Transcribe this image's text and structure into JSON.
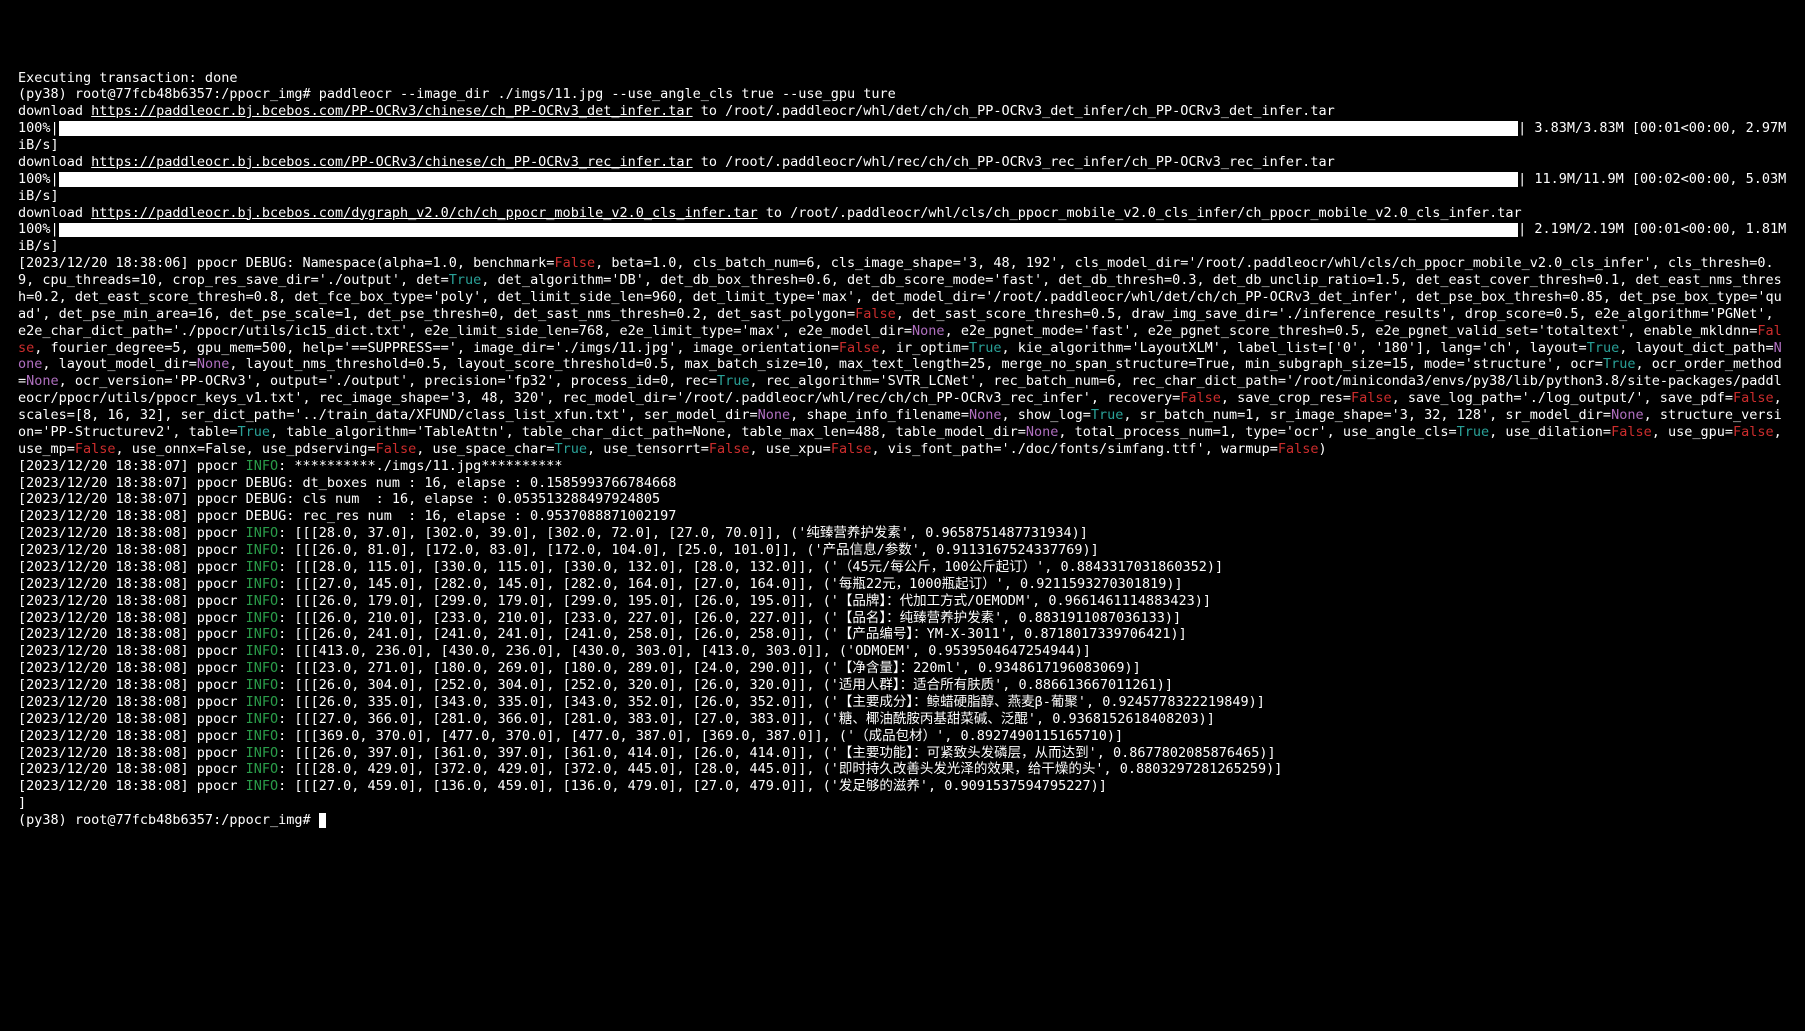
{
  "lines": {
    "l0": "Executing transaction: done",
    "l1_prompt": "(py38) root@77fcb48b6357:/ppocr_img# paddleocr --image_dir ./imgs/11.jpg --use_angle_cls true --use_gpu ture",
    "dl1_a": "download ",
    "dl1_url": "https://paddleocr.bj.bcebos.com/PP-OCRv3/chinese/ch_PP-OCRv3_det_infer.tar",
    "dl1_b": " to /root/.paddleocr/whl/det/ch/ch_PP-OCRv3_det_infer/ch_PP-OCRv3_det_infer.tar",
    "p1_left": "100%|",
    "p1_right": "| 3.83M/3.83M [00:01<00:00, 2.97MiB/s]",
    "dl2_a": "download ",
    "dl2_url": "https://paddleocr.bj.bcebos.com/PP-OCRv3/chinese/ch_PP-OCRv3_rec_infer.tar",
    "dl2_b": " to /root/.paddleocr/whl/rec/ch/ch_PP-OCRv3_rec_infer/ch_PP-OCRv3_rec_infer.tar",
    "p2_left": "100%|",
    "p2_right": "| 11.9M/11.9M [00:02<00:00, 5.03MiB/s]",
    "dl3_a": "download ",
    "dl3_url": "https://paddleocr.bj.bcebos.com/dygraph_v2.0/ch/ch_ppocr_mobile_v2.0_cls_infer.tar",
    "dl3_b": " to /root/.paddleocr/whl/cls/ch_ppocr_mobile_v2.0_cls_infer/ch_ppocr_mobile_v2.0_cls_infer.tar",
    "p3_left": "100%|",
    "p3_right": "| 2.19M/2.19M [00:01<00:00, 1.81MiB/s]"
  },
  "debug_block": {
    "prefix": "[2023/12/20 18:38:06] ppocr DEBUG: Namespace(alpha=1.0, benchmark=",
    "seg": [
      {
        "t": "False",
        "c": "red"
      },
      {
        "t": ", beta=1.0, cls_batch_num=6, cls_image_shape='3, 48, 192', cls_model_dir='/root/.paddleocr/whl/cls/ch_ppocr_mobile_v2.0_cls_infer', cls_thresh=0.9, cpu_threads=10, crop_res_save_dir='./output', det=",
        "c": "white"
      },
      {
        "t": "True",
        "c": "cyan"
      },
      {
        "t": ", det_algorithm='DB', det_db_box_thresh=0.6, det_db_score_mode='fast', det_db_thresh=0.3, det_db_unclip_ratio=1.5, det_east_cover_thresh=0.1, det_east_nms_thresh=0.2, det_east_score_thresh=0.8, det_fce_box_type='poly', det_limit_side_len=960, det_limit_type='max', det_model_dir='/root/.paddleocr/whl/det/ch/ch_PP-OCRv3_det_infer', det_pse_box_thresh=0.85, det_pse_box_type='quad', det_pse_min_area=16, det_pse_scale=1, det_pse_thresh=0, det_sast_nms_thresh=0.2, det_sast_polygon=",
        "c": "white"
      },
      {
        "t": "False",
        "c": "red"
      },
      {
        "t": ", det_sast_score_thresh=0.5, draw_img_save_dir='./inference_results', drop_score=0.5, e2e_algorithm='PGNet', e2e_char_dict_path='./ppocr/utils/ic15_dict.txt', e2e_limit_side_len=768, e2e_limit_type='max', e2e_model_dir=",
        "c": "white"
      },
      {
        "t": "None",
        "c": "purple"
      },
      {
        "t": ", e2e_pgnet_mode='fast', e2e_pgnet_score_thresh=0.5, e2e_pgnet_valid_set='totaltext', enable_mkldnn=",
        "c": "white"
      },
      {
        "t": "False",
        "c": "red"
      },
      {
        "t": ", fourier_degree=5, gpu_mem=500, help='==SUPPRESS==', image_dir='./imgs/11.jpg', image_orientation=",
        "c": "white"
      },
      {
        "t": "False",
        "c": "red"
      },
      {
        "t": ", ir_optim=",
        "c": "white"
      },
      {
        "t": "True",
        "c": "cyan"
      },
      {
        "t": ", kie_algorithm='LayoutXLM', label_list=['0', '180'], lang='ch', layout=",
        "c": "white"
      },
      {
        "t": "True",
        "c": "cyan"
      },
      {
        "t": ", layout_dict_path=",
        "c": "white"
      },
      {
        "t": "None",
        "c": "purple"
      },
      {
        "t": ", layout_model_dir=",
        "c": "white"
      },
      {
        "t": "None",
        "c": "purple"
      },
      {
        "t": ", layout_nms_threshold=0.5, layout_score_threshold=0.5, max_batch_size=10, max_text_length=25, merge_no_span_structure=True, min_subgraph_size=15, mode='structure', ocr=",
        "c": "white"
      },
      {
        "t": "True",
        "c": "cyan"
      },
      {
        "t": ", ocr_order_method=",
        "c": "white"
      },
      {
        "t": "None",
        "c": "purple"
      },
      {
        "t": ", ocr_version='PP-OCRv3', output='./output', precision='fp32', process_id=0, rec=",
        "c": "white"
      },
      {
        "t": "True",
        "c": "cyan"
      },
      {
        "t": ", rec_algorithm='SVTR_LCNet', rec_batch_num=6, rec_char_dict_path='/root/miniconda3/envs/py38/lib/python3.8/site-packages/paddleocr/ppocr/utils/ppocr_keys_v1.txt', rec_image_shape='3, 48, 320', rec_model_dir='/root/.paddleocr/whl/rec/ch/ch_PP-OCRv3_rec_infer', recovery=",
        "c": "white"
      },
      {
        "t": "False",
        "c": "red"
      },
      {
        "t": ", save_crop_res=",
        "c": "white"
      },
      {
        "t": "False",
        "c": "red"
      },
      {
        "t": ", save_log_path='./log_output/', save_pdf=",
        "c": "white"
      },
      {
        "t": "False",
        "c": "red"
      },
      {
        "t": ", scales=[8, 16, 32], ser_dict_path='../train_data/XFUND/class_list_xfun.txt', ser_model_dir=",
        "c": "white"
      },
      {
        "t": "None",
        "c": "purple"
      },
      {
        "t": ", shape_info_filename=",
        "c": "white"
      },
      {
        "t": "None",
        "c": "purple"
      },
      {
        "t": ", show_log=",
        "c": "white"
      },
      {
        "t": "True",
        "c": "cyan"
      },
      {
        "t": ", sr_batch_num=1, sr_image_shape='3, 32, 128', sr_model_dir=",
        "c": "white"
      },
      {
        "t": "None",
        "c": "purple"
      },
      {
        "t": ", structure_version='PP-Structurev2', table=",
        "c": "white"
      },
      {
        "t": "True",
        "c": "cyan"
      },
      {
        "t": ", table_algorithm='TableAttn', table_char_dict_path=None, table_max_len=488, table_model_dir=",
        "c": "white"
      },
      {
        "t": "None",
        "c": "purple"
      },
      {
        "t": ", total_process_num=1, type='ocr', use_angle_cls=",
        "c": "white"
      },
      {
        "t": "True",
        "c": "cyan"
      },
      {
        "t": ", use_dilation=",
        "c": "white"
      },
      {
        "t": "False",
        "c": "red"
      },
      {
        "t": ", use_gpu=",
        "c": "white"
      },
      {
        "t": "False",
        "c": "red"
      },
      {
        "t": ", use_mp=",
        "c": "white"
      },
      {
        "t": "False",
        "c": "red"
      },
      {
        "t": ", use_onnx=False, use_pdserving=",
        "c": "white"
      },
      {
        "t": "False",
        "c": "red"
      },
      {
        "t": ", use_space_char=",
        "c": "white"
      },
      {
        "t": "True",
        "c": "cyan"
      },
      {
        "t": ", use_tensorrt=",
        "c": "white"
      },
      {
        "t": "False",
        "c": "red"
      },
      {
        "t": ", use_xpu=",
        "c": "white"
      },
      {
        "t": "False",
        "c": "red"
      },
      {
        "t": ", vis_font_path='./doc/fonts/simfang.ttf', warmup=",
        "c": "white"
      },
      {
        "t": "False",
        "c": "red"
      },
      {
        "t": ")",
        "c": "white"
      }
    ]
  },
  "info_lines": [
    {
      "ts": "[2023/12/20 18:38:07] ppocr ",
      "lvl": "INFO",
      "rest": ": **********./imgs/11.jpg**********"
    },
    {
      "ts": "[2023/12/20 18:38:07] ppocr ",
      "lvl": "DEBUG",
      "rest": ": dt_boxes num : 16, elapse : 0.1585993766784668"
    },
    {
      "ts": "[2023/12/20 18:38:07] ppocr ",
      "lvl": "DEBUG",
      "rest": ": cls num  : 16, elapse : 0.053513288497924805"
    },
    {
      "ts": "[2023/12/20 18:38:08] ppocr ",
      "lvl": "DEBUG",
      "rest": ": rec_res num  : 16, elapse : 0.9537088871002197"
    },
    {
      "ts": "[2023/12/20 18:38:08] ppocr ",
      "lvl": "INFO",
      "rest": ": [[[28.0, 37.0], [302.0, 39.0], [302.0, 72.0], [27.0, 70.0]], ('纯臻营养护发素', 0.9658751487731934)]"
    },
    {
      "ts": "[2023/12/20 18:38:08] ppocr ",
      "lvl": "INFO",
      "rest": ": [[[26.0, 81.0], [172.0, 83.0], [172.0, 104.0], [25.0, 101.0]], ('产品信息/参数', 0.9113167524337769)]"
    },
    {
      "ts": "[2023/12/20 18:38:08] ppocr ",
      "lvl": "INFO",
      "rest": ": [[[28.0, 115.0], [330.0, 115.0], [330.0, 132.0], [28.0, 132.0]], ('（45元/每公斤，100公斤起订）', 0.8843317031860352)]"
    },
    {
      "ts": "[2023/12/20 18:38:08] ppocr ",
      "lvl": "INFO",
      "rest": ": [[[27.0, 145.0], [282.0, 145.0], [282.0, 164.0], [27.0, 164.0]], ('每瓶22元，1000瓶起订）', 0.9211593270301819)]"
    },
    {
      "ts": "[2023/12/20 18:38:08] ppocr ",
      "lvl": "INFO",
      "rest": ": [[[26.0, 179.0], [299.0, 179.0], [299.0, 195.0], [26.0, 195.0]], ('【品牌】：代加工方式/OEMODM', 0.9661461114883423)]"
    },
    {
      "ts": "[2023/12/20 18:38:08] ppocr ",
      "lvl": "INFO",
      "rest": ": [[[26.0, 210.0], [233.0, 210.0], [233.0, 227.0], [26.0, 227.0]], ('【品名】：纯臻营养护发素', 0.8831911087036133)]"
    },
    {
      "ts": "[2023/12/20 18:38:08] ppocr ",
      "lvl": "INFO",
      "rest": ": [[[26.0, 241.0], [241.0, 241.0], [241.0, 258.0], [26.0, 258.0]], ('【产品编号】：YM-X-3011', 0.8718017339706421)]"
    },
    {
      "ts": "[2023/12/20 18:38:08] ppocr ",
      "lvl": "INFO",
      "rest": ": [[[413.0, 236.0], [430.0, 236.0], [430.0, 303.0], [413.0, 303.0]], ('ODMOEM', 0.9539504647254944)]"
    },
    {
      "ts": "[2023/12/20 18:38:08] ppocr ",
      "lvl": "INFO",
      "rest": ": [[[23.0, 271.0], [180.0, 269.0], [180.0, 289.0], [24.0, 290.0]], ('【净含量】：220ml', 0.9348617196083069)]"
    },
    {
      "ts": "[2023/12/20 18:38:08] ppocr ",
      "lvl": "INFO",
      "rest": ": [[[26.0, 304.0], [252.0, 304.0], [252.0, 320.0], [26.0, 320.0]], ('适用人群】：适合所有肤质', 0.886613667011261)]"
    },
    {
      "ts": "[2023/12/20 18:38:08] ppocr ",
      "lvl": "INFO",
      "rest": ": [[[26.0, 335.0], [343.0, 335.0], [343.0, 352.0], [26.0, 352.0]], ('【主要成分】：鲸蜡硬脂醇、燕麦β-葡聚', 0.9245778322219849)]"
    },
    {
      "ts": "[2023/12/20 18:38:08] ppocr ",
      "lvl": "INFO",
      "rest": ": [[[27.0, 366.0], [281.0, 366.0], [281.0, 383.0], [27.0, 383.0]], ('糖、椰油酰胺丙基甜菜碱、泛醌', 0.9368152618408203)]"
    },
    {
      "ts": "[2023/12/20 18:38:08] ppocr ",
      "lvl": "INFO",
      "rest": ": [[[369.0, 370.0], [477.0, 370.0], [477.0, 387.0], [369.0, 387.0]], ('（成品包材）', 0.8927490115165710)]"
    },
    {
      "ts": "[2023/12/20 18:38:08] ppocr ",
      "lvl": "INFO",
      "rest": ": [[[26.0, 397.0], [361.0, 397.0], [361.0, 414.0], [26.0, 414.0]], ('【主要功能】：可紧致头发磷层，从而达到', 0.8677802085876465)]"
    },
    {
      "ts": "[2023/12/20 18:38:08] ppocr ",
      "lvl": "INFO",
      "rest": ": [[[28.0, 429.0], [372.0, 429.0], [372.0, 445.0], [28.0, 445.0]], ('即时持久改善头发光泽的效果，给干燥的头', 0.8803297281265259)]"
    },
    {
      "ts": "[2023/12/20 18:38:08] ppocr ",
      "lvl": "INFO",
      "rest": ": [[[27.0, 459.0], [136.0, 459.0], [136.0, 479.0], [27.0, 479.0]], ('发足够的滋养', 0.9091537594795227)]"
    }
  ],
  "trailing_bracket": "]",
  "final_prompt": "(py38) root@77fcb48b6357:/ppocr_img# "
}
